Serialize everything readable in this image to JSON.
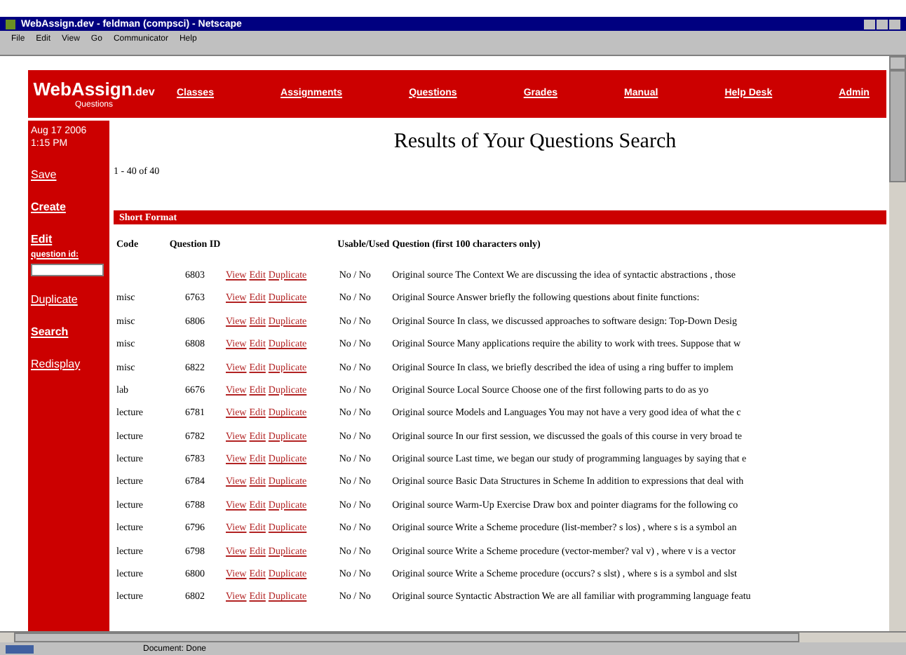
{
  "window": {
    "title": "WebAssign.dev - feldman (compsci) - Netscape"
  },
  "menu": [
    "File",
    "Edit",
    "View",
    "Go",
    "Communicator",
    "Help"
  ],
  "header": {
    "logo": "WebAssign",
    "logo_suffix": ".dev",
    "subtitle": "Questions",
    "nav": [
      "Classes",
      "Assignments",
      "Questions",
      "Grades",
      "Manual",
      "Help Desk",
      "Admin"
    ]
  },
  "sidebar": {
    "date": "Aug 17 2006 1:15 PM",
    "links": [
      {
        "kind": "link",
        "label": "Save",
        "bold": false
      },
      {
        "kind": "link",
        "label": "Create",
        "bold": true
      },
      {
        "kind": "link",
        "label": "Edit",
        "bold": true
      },
      {
        "kind": "field",
        "label": "question id:"
      },
      {
        "kind": "link",
        "label": "Duplicate",
        "bold": false
      },
      {
        "kind": "link",
        "label": "Search",
        "bold": true
      },
      {
        "kind": "link",
        "label": "Redisplay",
        "bold": false
      }
    ]
  },
  "page_title": "Results of Your Questions Search",
  "count": "1 - 40 of 40",
  "section": "Short Format",
  "table": {
    "columns": [
      "Code",
      "Question ID",
      "",
      "Usable/Used",
      "Question (first 100 characters only)"
    ],
    "rows": [
      {
        "code": "",
        "id": "6803",
        "actions": [
          "View",
          "Edit",
          "Duplicate"
        ],
        "usable": "No / No",
        "question": "Original source The Context We are discussing the idea of syntactic abstractions , those"
      },
      {
        "code": "misc",
        "id": "6763",
        "actions": [
          "View",
          "Edit",
          "Duplicate"
        ],
        "usable": "No / No",
        "question": "Original Source Answer briefly the following questions about finite functions:"
      },
      {
        "code": "misc",
        "id": "6806",
        "actions": [
          "View",
          "Edit",
          "Duplicate"
        ],
        "usable": "No / No",
        "question": "Original Source In class, we discussed approaches to software design: Top-Down Desig"
      },
      {
        "code": "misc",
        "id": "6808",
        "actions": [
          "View",
          "Edit",
          "Duplicate"
        ],
        "usable": "No / No",
        "question": "Original Source Many applications require the ability to work with trees. Suppose that w"
      },
      {
        "code": "misc",
        "id": "6822",
        "actions": [
          "View",
          "Edit",
          "Duplicate"
        ],
        "usable": "No / No",
        "question": "Original Source In class, we briefly described the idea of using a ring buffer to implem"
      },
      {
        "code": "lab",
        "id": "6676",
        "actions": [
          "View",
          "Edit",
          "Duplicate"
        ],
        "usable": "No / No",
        "question": "Original Source Local Source Choose one of the first following parts to do as yo"
      },
      {
        "code": "lecture",
        "id": "6781",
        "actions": [
          "View",
          "Edit",
          "Duplicate"
        ],
        "usable": "No / No",
        "question": "Original source Models and Languages You may not have a very good idea of what the c"
      },
      {
        "code": "lecture",
        "id": "6782",
        "actions": [
          "View",
          "Edit",
          "Duplicate"
        ],
        "usable": "No / No",
        "question": "Original source In our first session, we discussed the goals of this course in very broad te"
      },
      {
        "code": "lecture",
        "id": "6783",
        "actions": [
          "View",
          "Edit",
          "Duplicate"
        ],
        "usable": "No / No",
        "question": "Original source Last time, we began our study of programming languages by saying that e"
      },
      {
        "code": "lecture",
        "id": "6784",
        "actions": [
          "View",
          "Edit",
          "Duplicate"
        ],
        "usable": "No / No",
        "question": "Original source Basic Data Structures in Scheme In addition to expressions that deal with"
      },
      {
        "code": "lecture",
        "id": "6788",
        "actions": [
          "View",
          "Edit",
          "Duplicate"
        ],
        "usable": "No / No",
        "question": "Original source Warm-Up Exercise Draw box and pointer diagrams for the following co"
      },
      {
        "code": "lecture",
        "id": "6796",
        "actions": [
          "View",
          "Edit",
          "Duplicate"
        ],
        "usable": "No / No",
        "question": "Original source Write a Scheme procedure (list-member? s los) , where s is a symbol an"
      },
      {
        "code": "lecture",
        "id": "6798",
        "actions": [
          "View",
          "Edit",
          "Duplicate"
        ],
        "usable": "No / No",
        "question": "Original source Write a Scheme procedure (vector-member? val v) , where v is a vector"
      },
      {
        "code": "lecture",
        "id": "6800",
        "actions": [
          "View",
          "Edit",
          "Duplicate"
        ],
        "usable": "No / No",
        "question": "Original source Write a Scheme procedure (occurs? s slst) , where s is a symbol and slst"
      },
      {
        "code": "lecture",
        "id": "6802",
        "actions": [
          "View",
          "Edit",
          "Duplicate"
        ],
        "usable": "No / No",
        "question": "Original source Syntactic Abstraction We are all familiar with programming language featu"
      }
    ]
  },
  "status_bar": "Document: Done"
}
